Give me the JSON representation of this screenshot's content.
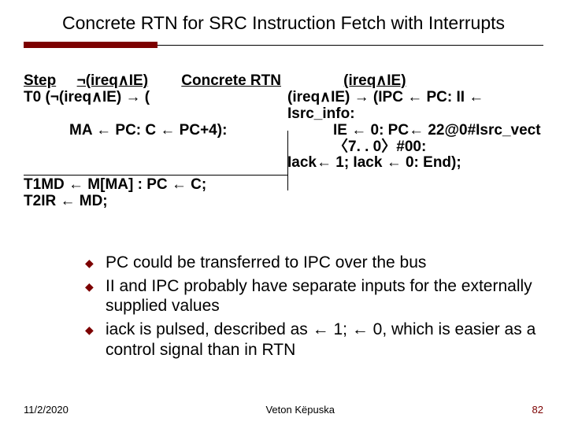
{
  "title": "Concrete RTN for SRC Instruction Fetch with Interrupts",
  "header": {
    "step": "Step",
    "col1": "¬(ireq∧IE)",
    "col2": "Concrete RTN",
    "col3": "(ireq∧IE)"
  },
  "t0": {
    "label": "T0",
    "left1": "(¬(ireq∧IE) → (",
    "right1": "(ireq∧IE) → (IPC ← PC: II ← Isrc_info:",
    "left2": "MA ← PC: C ← PC+4):",
    "right2": " IE ← 0: PC← 22@0#Isrc_vect〈7. . 0〉#00:",
    "right3": "Iack← 1;  Iack ← 0: End);"
  },
  "t1": {
    "label": "T1",
    "text": "MD ← M[MA] : PC ← C;"
  },
  "t2": {
    "label": "T2",
    "text": "IR ← MD;"
  },
  "bullets": [
    "PC could be transferred to IPC over the bus",
    "II and IPC probably have separate inputs for the externally supplied values",
    "iack is pulsed, described as ← 1; ← 0, which is easier as a control signal than in RTN"
  ],
  "footer": {
    "date": "11/2/2020",
    "author": "Veton Këpuska",
    "page": "82"
  }
}
